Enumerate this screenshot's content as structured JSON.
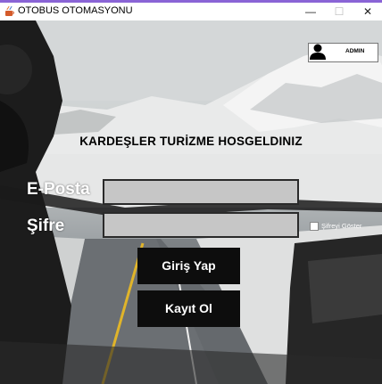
{
  "window": {
    "title": "OTOBUS OTOMASYONU",
    "minimize_symbol": "—",
    "maximize_symbol": "☐",
    "close_symbol": "✕"
  },
  "admin_button": {
    "label": "ADMIN",
    "icon": "user-icon"
  },
  "welcome_text": "KARDEŞLER TURİZME HOSGELDINIZ",
  "form": {
    "email_label": "E-Posta",
    "email_value": "",
    "password_label": "Şifre",
    "password_value": "",
    "show_password_label": "Şifreyi Göster",
    "show_password_checked": false
  },
  "buttons": {
    "login_label": "Giriş Yap",
    "register_label": "Kayıt Ol"
  },
  "colors": {
    "accent_topline": "#8a64d6",
    "field_bg": "#c6c6c6",
    "button_bg": "#0d0d0d"
  }
}
